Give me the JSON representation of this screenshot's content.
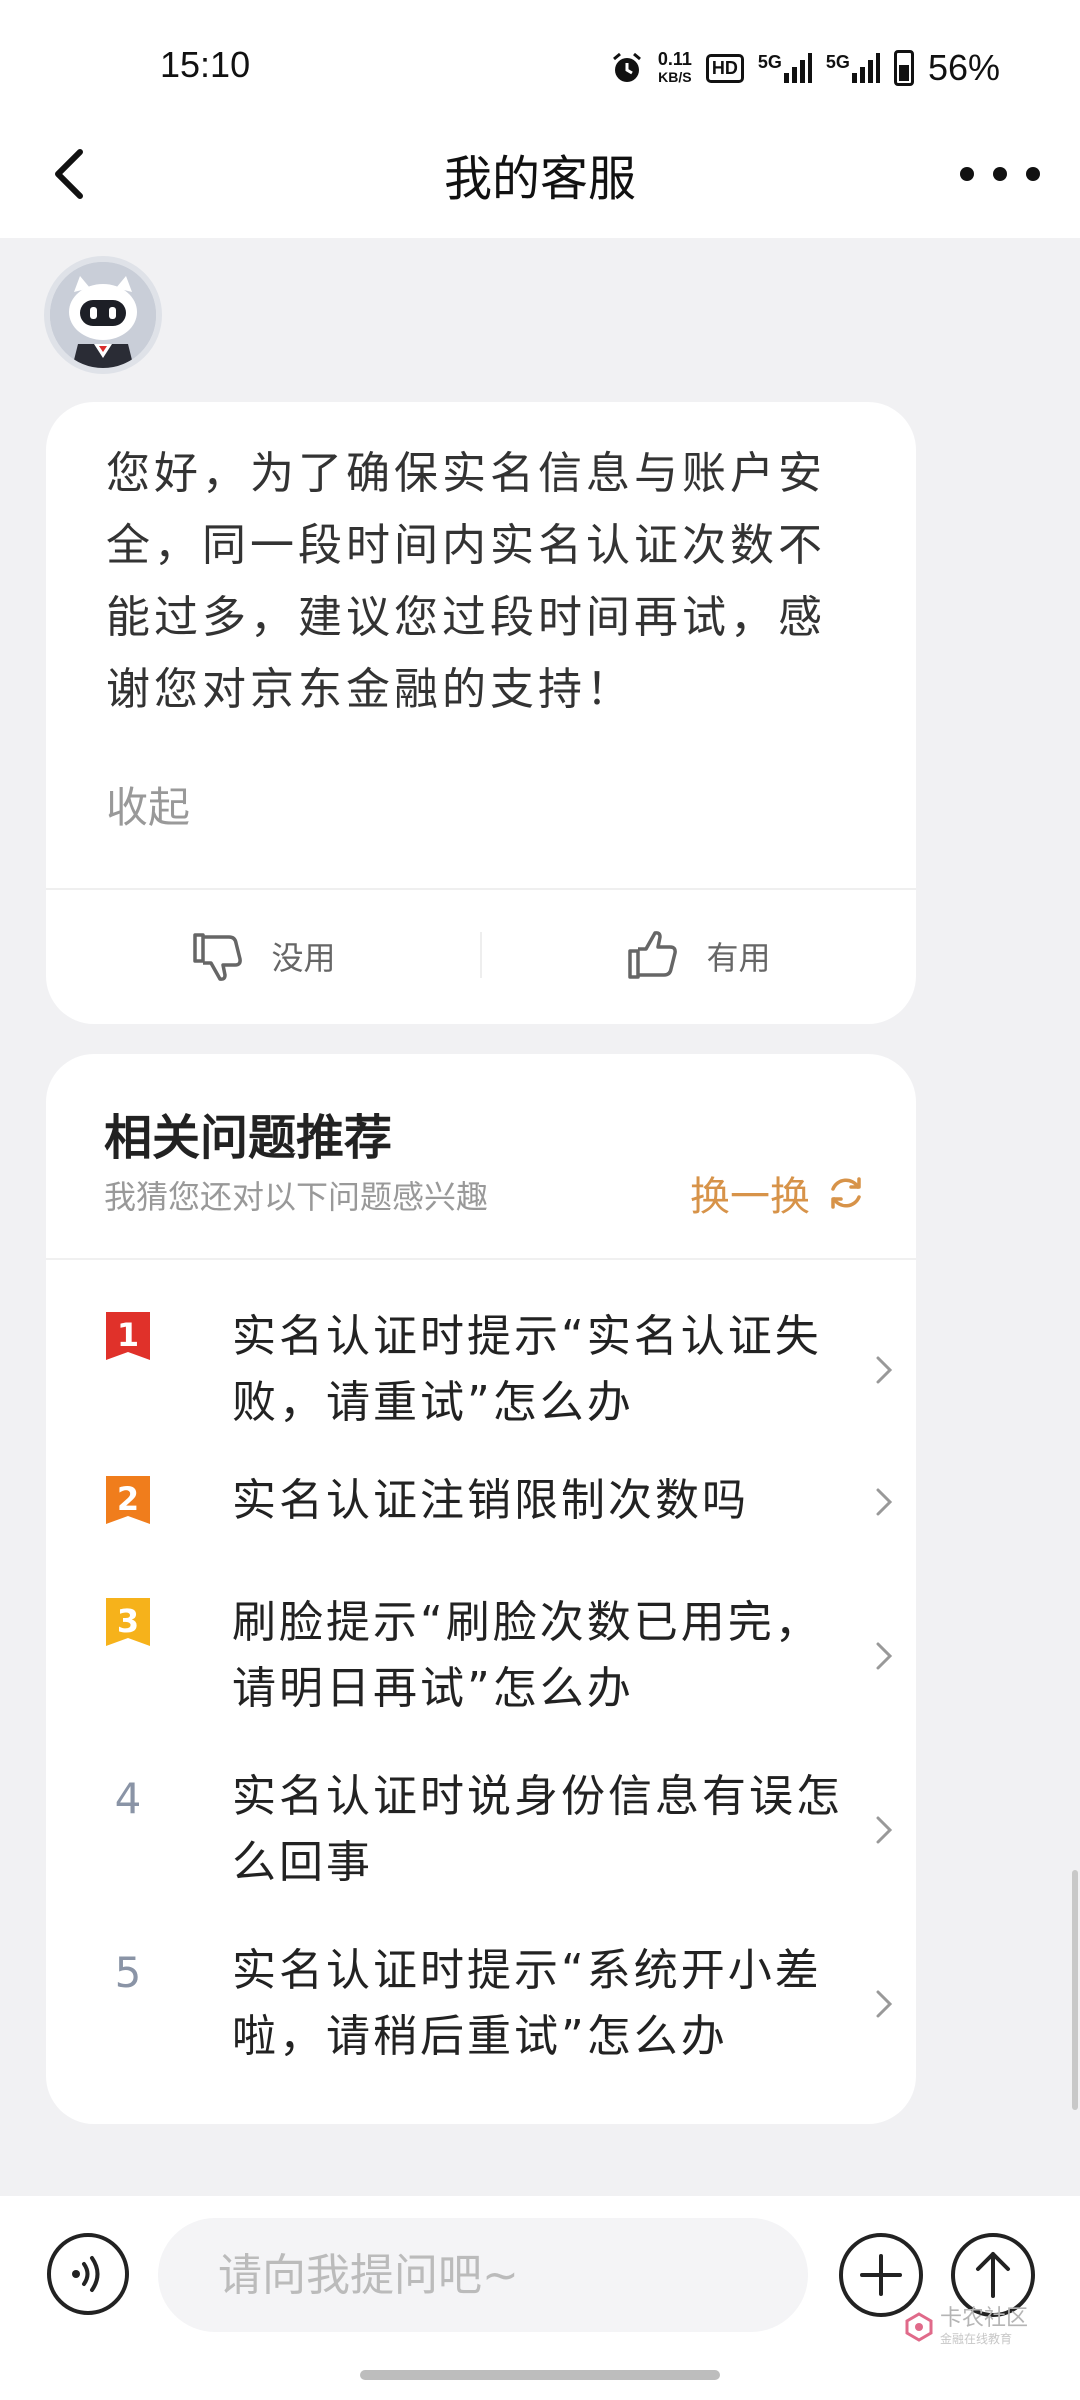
{
  "status_bar": {
    "time": "15:10",
    "net_speed_value": "0.11",
    "net_speed_unit": "KB/S",
    "hd_label": "HD",
    "signal_1": "5G",
    "signal_2": "5G",
    "battery": "56%"
  },
  "nav": {
    "title": "我的客服"
  },
  "message": {
    "text": "您好，为了确保实名信息与账户安全，同一段时间内实名认证次数不能过多，建议您过段时间再试，感谢您对京东金融的支持！",
    "collapse_label": "收起",
    "unhelpful_label": "没用",
    "helpful_label": "有用"
  },
  "related": {
    "title": "相关问题推荐",
    "subtitle": "我猜您还对以下问题感兴趣",
    "refresh_label": "换一换",
    "questions": [
      {
        "rank": "1",
        "text": "实名认证时提示“实名认证失败，请重试”怎么办"
      },
      {
        "rank": "2",
        "text": "实名认证注销限制次数吗"
      },
      {
        "rank": "3",
        "text": "刷脸提示“刷脸次数已用完，请明日再试”怎么办"
      },
      {
        "rank": "4",
        "text": "实名认证时说身份信息有误怎么回事"
      },
      {
        "rank": "5",
        "text": "实名认证时提示“系统开小差啦，请稍后重试”怎么办"
      }
    ],
    "rank_colors": [
      "#e0312a",
      "#f07d1c",
      "#f6b21b"
    ]
  },
  "input": {
    "placeholder": "请向我提问吧~"
  },
  "watermark": {
    "main": "卡农社区",
    "sub": "金融在线教育"
  },
  "colors": {
    "accent": "#d79349",
    "background": "#f1f1f3"
  }
}
